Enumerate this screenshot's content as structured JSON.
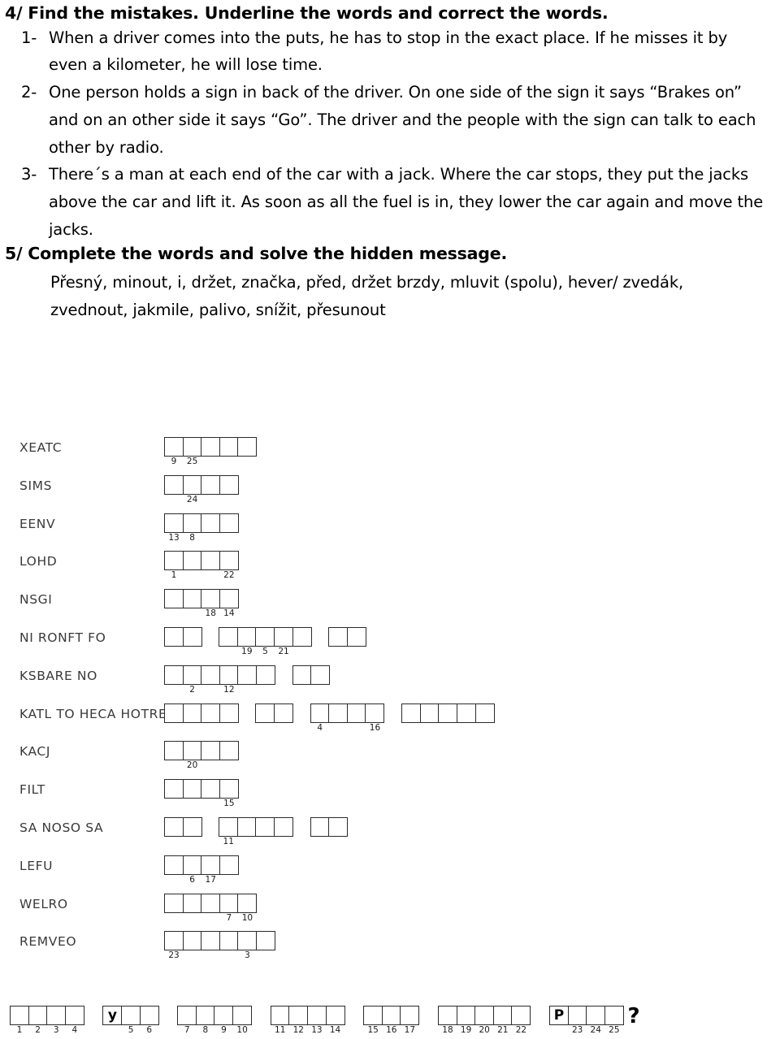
{
  "exercise4": {
    "heading": "4/ Find the mistakes. Underline the words and correct the words.",
    "questions": [
      {
        "num": "1-",
        "text": "When a driver comes into the puts, he has to stop in the exact place. If he misses it by even a kilometer, he will lose time."
      },
      {
        "num": "2-",
        "text": "One person holds a sign in back of the driver. On one side of the sign it says “Brakes on” and on an other side it says “Go”. The driver and the people with the sign can talk to each other by radio."
      },
      {
        "num": "3-",
        "text": "There´s a man at each end of the car with a jack. Where the car stops, they put the jacks above the car and lift it. As soon  as all the fuel is in, they lower the car again and move the jacks."
      }
    ]
  },
  "exercise5": {
    "heading": "5/ Complete the words and solve the hidden message.",
    "vocab": "Přesný, minout, i, držet, značka, před, držet brzdy, mluvit (spolu), hever/ zvedák, zvednout, jakmile, palivo, snížit, přesunout"
  },
  "puzzle": {
    "rows": [
      {
        "label": "XEATC",
        "groups": [
          {
            "cells": [
              {
                "idx": "9"
              },
              {
                "idx": "25"
              },
              {},
              {},
              {}
            ]
          }
        ]
      },
      {
        "label": "SIMS",
        "groups": [
          {
            "cells": [
              {},
              {
                "idx": "24"
              },
              {},
              {}
            ]
          }
        ]
      },
      {
        "label": "EENV",
        "groups": [
          {
            "cells": [
              {
                "idx": "13"
              },
              {
                "idx": "8"
              },
              {},
              {}
            ]
          }
        ]
      },
      {
        "label": "LOHD",
        "groups": [
          {
            "cells": [
              {
                "idx": "1"
              },
              {},
              {},
              {
                "idx": "22"
              }
            ]
          }
        ]
      },
      {
        "label": "NSGI",
        "groups": [
          {
            "cells": [
              {},
              {},
              {
                "idx": "18"
              },
              {
                "idx": "14"
              }
            ]
          }
        ]
      },
      {
        "label": "NI RONFT FO",
        "groups": [
          {
            "cells": [
              {},
              {}
            ]
          },
          {
            "cells": [
              {},
              {
                "idx": "19"
              },
              {
                "idx": "5"
              },
              {
                "idx": "21"
              },
              {}
            ]
          },
          {
            "cells": [
              {},
              {}
            ]
          }
        ]
      },
      {
        "label": "KSBARE NO",
        "groups": [
          {
            "cells": [
              {},
              {
                "idx": "2"
              },
              {},
              {
                "idx": "12"
              },
              {},
              {}
            ]
          },
          {
            "cells": [
              {},
              {}
            ]
          }
        ]
      },
      {
        "label": "KATL TO HECA HOTRE",
        "groups": [
          {
            "cells": [
              {},
              {},
              {},
              {}
            ]
          },
          {
            "cells": [
              {},
              {}
            ]
          },
          {
            "cells": [
              {
                "idx": "4"
              },
              {},
              {},
              {
                "idx": "16"
              }
            ]
          },
          {
            "cells": [
              {},
              {},
              {},
              {},
              {}
            ]
          }
        ]
      },
      {
        "label": "KACJ",
        "groups": [
          {
            "cells": [
              {},
              {
                "idx": "20"
              },
              {},
              {}
            ]
          }
        ]
      },
      {
        "label": "FILT",
        "groups": [
          {
            "cells": [
              {},
              {},
              {},
              {
                "idx": "15"
              }
            ]
          }
        ]
      },
      {
        "label": "SA NOSO SA",
        "groups": [
          {
            "cells": [
              {},
              {}
            ]
          },
          {
            "cells": [
              {
                "idx": "11"
              },
              {},
              {},
              {}
            ]
          },
          {
            "cells": [
              {},
              {}
            ]
          }
        ]
      },
      {
        "label": "LEFU",
        "groups": [
          {
            "cells": [
              {},
              {
                "idx": "6"
              },
              {
                "idx": "17"
              },
              {}
            ]
          }
        ]
      },
      {
        "label": "WELRO",
        "groups": [
          {
            "cells": [
              {},
              {},
              {},
              {
                "idx": "7"
              },
              {
                "idx": "10"
              }
            ]
          }
        ]
      },
      {
        "label": "REMVEO",
        "groups": [
          {
            "cells": [
              {
                "idx": "23"
              },
              {},
              {},
              {},
              {
                "idx": "3"
              },
              {}
            ]
          }
        ]
      }
    ]
  },
  "answer_strip": {
    "groups": [
      {
        "cells": [
          {
            "idx": "1"
          },
          {
            "idx": "2"
          },
          {
            "idx": "3"
          },
          {
            "idx": "4"
          }
        ]
      },
      {
        "cells": [
          {
            "letter": "y"
          },
          {
            "idx": "5"
          },
          {
            "idx": "6"
          }
        ]
      },
      {
        "cells": [
          {
            "idx": "7"
          },
          {
            "idx": "8"
          },
          {
            "idx": "9"
          },
          {
            "idx": "10"
          }
        ]
      },
      {
        "cells": [
          {
            "idx": "11"
          },
          {
            "idx": "12"
          },
          {
            "idx": "13"
          },
          {
            "idx": "14"
          }
        ]
      },
      {
        "cells": [
          {
            "idx": "15"
          },
          {
            "idx": "16"
          },
          {
            "idx": "17"
          }
        ]
      },
      {
        "cells": [
          {
            "idx": "18"
          },
          {
            "idx": "19"
          },
          {
            "idx": "20"
          },
          {
            "idx": "21"
          },
          {
            "idx": "22"
          }
        ]
      },
      {
        "cells": [
          {
            "letter": "P"
          },
          {
            "idx": "23"
          },
          {
            "idx": "24"
          },
          {
            "idx": "25"
          }
        ]
      }
    ],
    "question_mark": "?"
  }
}
